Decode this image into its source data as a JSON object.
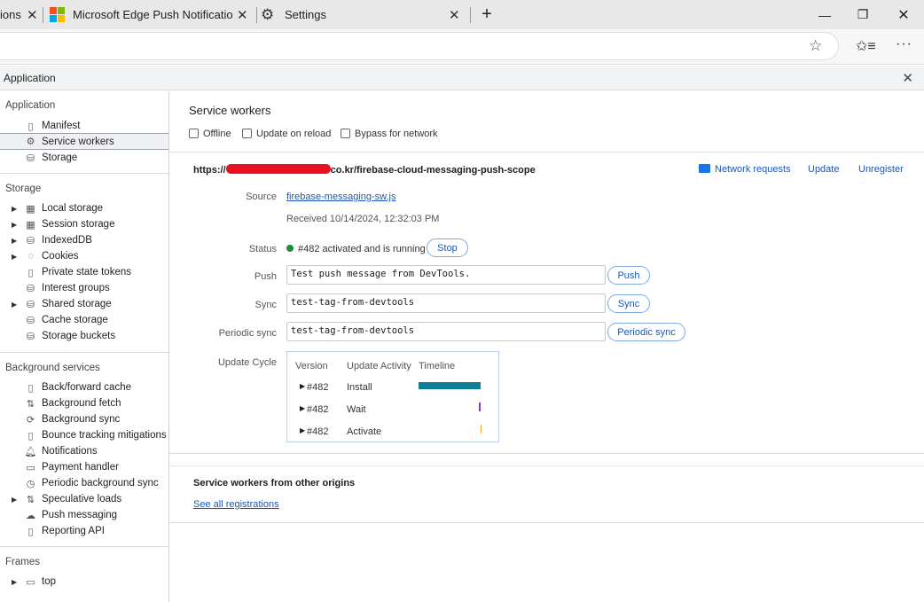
{
  "tabs": [
    {
      "title": "ions"
    },
    {
      "title": "Microsoft Edge Push Notifications"
    },
    {
      "title": "Settings"
    }
  ],
  "devtools": {
    "title": "Application"
  },
  "sidebar": {
    "application": {
      "header": "Application",
      "items": [
        {
          "label": "Manifest",
          "icon": "file-icon"
        },
        {
          "label": "Service workers",
          "icon": "gear-icon"
        },
        {
          "label": "Storage",
          "icon": "database-icon"
        }
      ]
    },
    "storage": {
      "header": "Storage",
      "items": [
        {
          "label": "Local storage",
          "icon": "grid-icon",
          "expandable": true
        },
        {
          "label": "Session storage",
          "icon": "grid-icon",
          "expandable": true
        },
        {
          "label": "IndexedDB",
          "icon": "database-icon",
          "expandable": true
        },
        {
          "label": "Cookies",
          "icon": "cookie-icon",
          "expandable": true
        },
        {
          "label": "Private state tokens",
          "icon": "file-icon"
        },
        {
          "label": "Interest groups",
          "icon": "database-icon"
        },
        {
          "label": "Shared storage",
          "icon": "database-icon",
          "expandable": true
        },
        {
          "label": "Cache storage",
          "icon": "database-icon"
        },
        {
          "label": "Storage buckets",
          "icon": "database-icon"
        }
      ]
    },
    "background": {
      "header": "Background services",
      "items": [
        {
          "label": "Back/forward cache",
          "icon": "file-icon"
        },
        {
          "label": "Background fetch",
          "icon": "arrows-icon"
        },
        {
          "label": "Background sync",
          "icon": "sync-icon"
        },
        {
          "label": "Bounce tracking mitigations",
          "icon": "file-icon"
        },
        {
          "label": "Notifications",
          "icon": "bell-icon"
        },
        {
          "label": "Payment handler",
          "icon": "card-icon"
        },
        {
          "label": "Periodic background sync",
          "icon": "clock-icon"
        },
        {
          "label": "Speculative loads",
          "icon": "arrows-icon",
          "expandable": true
        },
        {
          "label": "Push messaging",
          "icon": "cloud-icon"
        },
        {
          "label": "Reporting API",
          "icon": "file-icon"
        }
      ]
    },
    "frames": {
      "header": "Frames",
      "items": [
        {
          "label": "top",
          "icon": "window-icon",
          "expandable": true
        }
      ]
    }
  },
  "sw": {
    "title": "Service workers",
    "offline": "Offline",
    "update_on_reload": "Update on reload",
    "bypass": "Bypass for network",
    "scope_prefix": "https://",
    "scope_suffix": "co.kr/firebase-cloud-messaging-push-scope",
    "network_requests": "Network requests",
    "update": "Update",
    "unregister": "Unregister",
    "source_label": "Source",
    "source_file": "firebase-messaging-sw.js",
    "received": "Received 10/14/2024, 12:32:03 PM",
    "status_label": "Status",
    "status_text": "#482 activated and is running",
    "stop": "Stop",
    "push_label": "Push",
    "push_value": "Test push message from DevTools.",
    "push_btn": "Push",
    "sync_label": "Sync",
    "sync_value": "test-tag-from-devtools",
    "sync_btn": "Sync",
    "psync_label": "Periodic sync",
    "psync_value": "test-tag-from-devtools",
    "psync_btn": "Periodic sync",
    "cycle_label": "Update Cycle",
    "cycle_headers": [
      "Version",
      "Update Activity",
      "Timeline"
    ],
    "cycle_rows": [
      {
        "version": "#482",
        "activity": "Install",
        "color": "#0f7f95"
      },
      {
        "version": "#482",
        "activity": "Wait",
        "color": "#9b30c8"
      },
      {
        "version": "#482",
        "activity": "Activate",
        "color": "#f0a030"
      }
    ],
    "other_title": "Service workers from other origins",
    "see_all": "See all registrations"
  },
  "colors": {
    "status_dot": "#1e8e3e",
    "redaction": "#e81123",
    "link": "#1a56b8"
  }
}
